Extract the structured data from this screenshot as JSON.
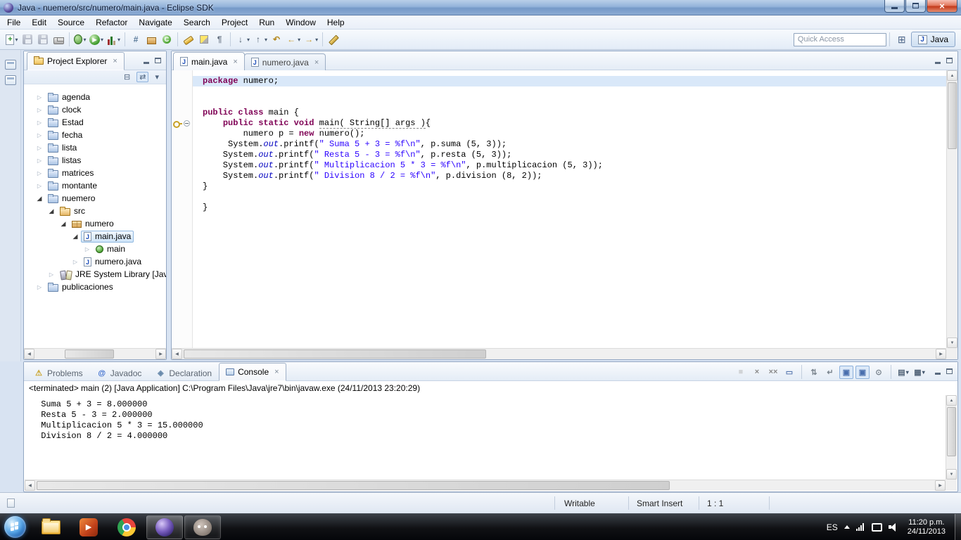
{
  "colors": {
    "keyword": "#7f0055",
    "string": "#2a00ff",
    "static_field": "#0000c0"
  },
  "window": {
    "title": "Java - nuemero/src/numero/main.java - Eclipse SDK"
  },
  "menu": {
    "items": [
      "File",
      "Edit",
      "Source",
      "Refactor",
      "Navigate",
      "Search",
      "Project",
      "Run",
      "Window",
      "Help"
    ]
  },
  "toolbar": {
    "quick_access_placeholder": "Quick Access",
    "java_perspective_label": "Java",
    "items": [
      {
        "name": "new",
        "glyph": "+",
        "dropdown": true
      },
      {
        "name": "save",
        "disabled": true
      },
      {
        "name": "save-all",
        "disabled": true
      },
      {
        "name": "print"
      },
      {
        "sep": true
      },
      {
        "name": "debug",
        "dropdown": true
      },
      {
        "name": "run",
        "glyph": "▶",
        "dropdown": true
      },
      {
        "name": "coverage",
        "dropdown": true
      },
      {
        "sep": true
      },
      {
        "name": "new-java-project",
        "glyph": "#",
        "color": "#5a7a9a"
      },
      {
        "name": "new-package"
      },
      {
        "name": "new-class",
        "glyph": "C"
      },
      {
        "sep": true
      },
      {
        "name": "search"
      },
      {
        "name": "mark-occurrences"
      },
      {
        "name": "show-whitespace",
        "glyph": "¶",
        "color": "#6a7686"
      },
      {
        "sep": true
      },
      {
        "name": "next-annotation",
        "glyph": "↓",
        "color": "#4a5a6a",
        "dropdown": true
      },
      {
        "name": "previous-annotation",
        "glyph": "↑",
        "color": "#4a5a6a",
        "dropdown": true
      },
      {
        "name": "last-edit-location",
        "glyph": "↶",
        "color": "#b58a20"
      },
      {
        "name": "back",
        "glyph": "←",
        "color": "#c89b2a",
        "dropdown": true
      },
      {
        "name": "forward",
        "glyph": "→",
        "color": "#c89b2a",
        "dropdown": true
      },
      {
        "sep": true
      },
      {
        "name": "block-selection"
      }
    ]
  },
  "project_explorer": {
    "title": "Project Explorer",
    "tree": [
      {
        "label": "agenda",
        "depth": 0,
        "state": "collapsed",
        "icon": "project"
      },
      {
        "label": "clock",
        "depth": 0,
        "state": "collapsed",
        "icon": "project"
      },
      {
        "label": "Estad",
        "depth": 0,
        "state": "collapsed",
        "icon": "project"
      },
      {
        "label": "fecha",
        "depth": 0,
        "state": "collapsed",
        "icon": "project"
      },
      {
        "label": "lista",
        "depth": 0,
        "state": "collapsed",
        "icon": "project"
      },
      {
        "label": "listas",
        "depth": 0,
        "state": "collapsed",
        "icon": "project"
      },
      {
        "label": "matrices",
        "depth": 0,
        "state": "collapsed",
        "icon": "project"
      },
      {
        "label": "montante",
        "depth": 0,
        "state": "collapsed",
        "icon": "project"
      },
      {
        "label": "nuemero",
        "depth": 0,
        "state": "expanded",
        "icon": "project"
      },
      {
        "label": "src",
        "depth": 1,
        "state": "expanded",
        "icon": "src"
      },
      {
        "label": "numero",
        "depth": 2,
        "state": "expanded",
        "icon": "package"
      },
      {
        "label": "main.java",
        "depth": 3,
        "state": "expanded",
        "icon": "jfile",
        "selected": true
      },
      {
        "label": "main",
        "depth": 4,
        "state": "collapsed",
        "icon": "class"
      },
      {
        "label": "numero.java",
        "depth": 3,
        "state": "collapsed",
        "icon": "jfile"
      },
      {
        "label": "JRE System Library [Java",
        "depth": 1,
        "state": "collapsed",
        "icon": "library"
      },
      {
        "label": "publicaciones",
        "depth": 0,
        "state": "collapsed",
        "icon": "project"
      }
    ]
  },
  "editor": {
    "tabs": [
      {
        "label": "main.java",
        "active": true
      },
      {
        "label": "numero.java",
        "active": false
      }
    ],
    "code_lines": [
      {
        "hl": true,
        "t": [
          [
            "k",
            "package"
          ],
          [
            "p",
            " numero;"
          ]
        ]
      },
      {
        "t": []
      },
      {
        "t": []
      },
      {
        "t": [
          [
            "k",
            "public"
          ],
          [
            "p",
            " "
          ],
          [
            "k",
            "class"
          ],
          [
            "p",
            " main {"
          ]
        ]
      },
      {
        "t": [
          [
            "p",
            "    "
          ],
          [
            "k",
            "public"
          ],
          [
            "p",
            " "
          ],
          [
            "k",
            "static"
          ],
          [
            "p",
            " "
          ],
          [
            "k",
            "void"
          ],
          [
            "p",
            " "
          ],
          [
            "d",
            "main( String[] args )"
          ],
          [
            "p",
            "{"
          ]
        ]
      },
      {
        "t": [
          [
            "p",
            "        numero p = "
          ],
          [
            "k",
            "new"
          ],
          [
            "p",
            " numero();"
          ]
        ]
      },
      {
        "t": [
          [
            "p",
            "     System."
          ],
          [
            "f",
            "out"
          ],
          [
            "p",
            ".printf("
          ],
          [
            "s",
            "\" Suma 5 + 3 = %f\\n\""
          ],
          [
            "p",
            ", p.suma (5, 3));"
          ]
        ]
      },
      {
        "t": [
          [
            "p",
            "    System."
          ],
          [
            "f",
            "out"
          ],
          [
            "p",
            ".printf("
          ],
          [
            "s",
            "\" Resta 5 - 3 = %f\\n\""
          ],
          [
            "p",
            ", p.resta (5, 3));"
          ]
        ]
      },
      {
        "t": [
          [
            "p",
            "    System."
          ],
          [
            "f",
            "out"
          ],
          [
            "p",
            ".printf("
          ],
          [
            "s",
            "\" Multiplicacion 5 * 3 = %f\\n\""
          ],
          [
            "p",
            ", p.multiplicacion (5, 3));"
          ]
        ]
      },
      {
        "t": [
          [
            "p",
            "    System."
          ],
          [
            "f",
            "out"
          ],
          [
            "p",
            ".printf("
          ],
          [
            "s",
            "\" Division 8 / 2 = %f\\n\""
          ],
          [
            "p",
            ", p.division (8, 2));"
          ]
        ]
      },
      {
        "t": [
          [
            "p",
            "}"
          ]
        ]
      },
      {
        "t": []
      },
      {
        "t": [
          [
            "p",
            "}"
          ]
        ]
      }
    ]
  },
  "console": {
    "tabs": [
      {
        "name": "problems",
        "label": "Problems",
        "glyph": "⚠",
        "color": "#c9a227"
      },
      {
        "name": "javadoc",
        "label": "Javadoc",
        "glyph": "@",
        "color": "#3366cc"
      },
      {
        "name": "declaration",
        "label": "Declaration",
        "glyph": "◈",
        "color": "#6688aa"
      },
      {
        "name": "console",
        "label": "Console",
        "active": true
      }
    ],
    "toolbar": [
      {
        "name": "terminate",
        "glyph": "■",
        "color": "#b5b5b5",
        "disabled": true
      },
      {
        "name": "remove-launch",
        "glyph": "×",
        "color": "#8a8a8a"
      },
      {
        "name": "remove-all-launches",
        "glyph": "××",
        "color": "#8a8a8a"
      },
      {
        "name": "clear-console",
        "glyph": "▭",
        "color": "#5a7ab0"
      },
      {
        "sep": true
      },
      {
        "name": "scroll-lock",
        "glyph": "⇅",
        "color": "#7a848e"
      },
      {
        "name": "word-wrap",
        "glyph": "↵",
        "color": "#7a848e"
      },
      {
        "name": "show-console-stdout",
        "glyph": "▣",
        "color": "#4a6fae",
        "pressed": true
      },
      {
        "name": "show-console-stderr",
        "glyph": "▣",
        "color": "#4a6fae",
        "pressed": true
      },
      {
        "name": "pin-console",
        "glyph": "⊙",
        "color": "#7a848e"
      },
      {
        "sep": true
      },
      {
        "name": "display-selected-console",
        "glyph": "▤",
        "color": "#55667a",
        "dropdown": true
      },
      {
        "name": "open-console",
        "glyph": "▦",
        "color": "#55667a",
        "dropdown": true
      }
    ],
    "header": "<terminated> main (2) [Java Application] C:\\Program Files\\Java\\jre7\\bin\\javaw.exe (24/11/2013 23:20:29)",
    "output": [
      " Suma 5 + 3 = 8.000000",
      " Resta 5 - 3 = 2.000000",
      " Multiplicacion 5 * 3 = 15.000000",
      " Division 8 / 2 = 4.000000"
    ]
  },
  "status_bar": {
    "writable": "Writable",
    "insert_mode": "Smart Insert",
    "caret": "1 : 1"
  },
  "taskbar": {
    "apps": [
      {
        "name": "explorer"
      },
      {
        "name": "media-player"
      },
      {
        "name": "chrome"
      },
      {
        "name": "eclipse",
        "open": true,
        "focused": true
      },
      {
        "name": "gimp",
        "open": true
      }
    ],
    "tray": {
      "language": "ES",
      "time": "11:20 p.m.",
      "date": "24/11/2013"
    }
  }
}
